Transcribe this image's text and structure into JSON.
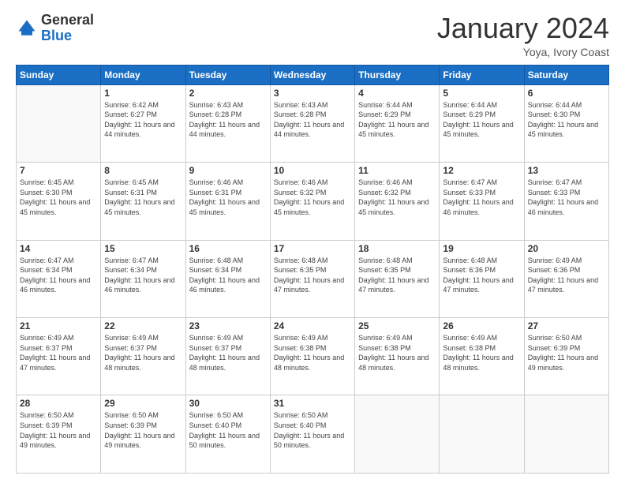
{
  "header": {
    "logo_general": "General",
    "logo_blue": "Blue",
    "month_title": "January 2024",
    "subtitle": "Yoya, Ivory Coast"
  },
  "days_of_week": [
    "Sunday",
    "Monday",
    "Tuesday",
    "Wednesday",
    "Thursday",
    "Friday",
    "Saturday"
  ],
  "weeks": [
    [
      {
        "day": "",
        "sunrise": "",
        "sunset": "",
        "daylight": ""
      },
      {
        "day": "1",
        "sunrise": "Sunrise: 6:42 AM",
        "sunset": "Sunset: 6:27 PM",
        "daylight": "Daylight: 11 hours and 44 minutes."
      },
      {
        "day": "2",
        "sunrise": "Sunrise: 6:43 AM",
        "sunset": "Sunset: 6:28 PM",
        "daylight": "Daylight: 11 hours and 44 minutes."
      },
      {
        "day": "3",
        "sunrise": "Sunrise: 6:43 AM",
        "sunset": "Sunset: 6:28 PM",
        "daylight": "Daylight: 11 hours and 44 minutes."
      },
      {
        "day": "4",
        "sunrise": "Sunrise: 6:44 AM",
        "sunset": "Sunset: 6:29 PM",
        "daylight": "Daylight: 11 hours and 45 minutes."
      },
      {
        "day": "5",
        "sunrise": "Sunrise: 6:44 AM",
        "sunset": "Sunset: 6:29 PM",
        "daylight": "Daylight: 11 hours and 45 minutes."
      },
      {
        "day": "6",
        "sunrise": "Sunrise: 6:44 AM",
        "sunset": "Sunset: 6:30 PM",
        "daylight": "Daylight: 11 hours and 45 minutes."
      }
    ],
    [
      {
        "day": "7",
        "sunrise": "Sunrise: 6:45 AM",
        "sunset": "Sunset: 6:30 PM",
        "daylight": "Daylight: 11 hours and 45 minutes."
      },
      {
        "day": "8",
        "sunrise": "Sunrise: 6:45 AM",
        "sunset": "Sunset: 6:31 PM",
        "daylight": "Daylight: 11 hours and 45 minutes."
      },
      {
        "day": "9",
        "sunrise": "Sunrise: 6:46 AM",
        "sunset": "Sunset: 6:31 PM",
        "daylight": "Daylight: 11 hours and 45 minutes."
      },
      {
        "day": "10",
        "sunrise": "Sunrise: 6:46 AM",
        "sunset": "Sunset: 6:32 PM",
        "daylight": "Daylight: 11 hours and 45 minutes."
      },
      {
        "day": "11",
        "sunrise": "Sunrise: 6:46 AM",
        "sunset": "Sunset: 6:32 PM",
        "daylight": "Daylight: 11 hours and 45 minutes."
      },
      {
        "day": "12",
        "sunrise": "Sunrise: 6:47 AM",
        "sunset": "Sunset: 6:33 PM",
        "daylight": "Daylight: 11 hours and 46 minutes."
      },
      {
        "day": "13",
        "sunrise": "Sunrise: 6:47 AM",
        "sunset": "Sunset: 6:33 PM",
        "daylight": "Daylight: 11 hours and 46 minutes."
      }
    ],
    [
      {
        "day": "14",
        "sunrise": "Sunrise: 6:47 AM",
        "sunset": "Sunset: 6:34 PM",
        "daylight": "Daylight: 11 hours and 46 minutes."
      },
      {
        "day": "15",
        "sunrise": "Sunrise: 6:47 AM",
        "sunset": "Sunset: 6:34 PM",
        "daylight": "Daylight: 11 hours and 46 minutes."
      },
      {
        "day": "16",
        "sunrise": "Sunrise: 6:48 AM",
        "sunset": "Sunset: 6:34 PM",
        "daylight": "Daylight: 11 hours and 46 minutes."
      },
      {
        "day": "17",
        "sunrise": "Sunrise: 6:48 AM",
        "sunset": "Sunset: 6:35 PM",
        "daylight": "Daylight: 11 hours and 47 minutes."
      },
      {
        "day": "18",
        "sunrise": "Sunrise: 6:48 AM",
        "sunset": "Sunset: 6:35 PM",
        "daylight": "Daylight: 11 hours and 47 minutes."
      },
      {
        "day": "19",
        "sunrise": "Sunrise: 6:48 AM",
        "sunset": "Sunset: 6:36 PM",
        "daylight": "Daylight: 11 hours and 47 minutes."
      },
      {
        "day": "20",
        "sunrise": "Sunrise: 6:49 AM",
        "sunset": "Sunset: 6:36 PM",
        "daylight": "Daylight: 11 hours and 47 minutes."
      }
    ],
    [
      {
        "day": "21",
        "sunrise": "Sunrise: 6:49 AM",
        "sunset": "Sunset: 6:37 PM",
        "daylight": "Daylight: 11 hours and 47 minutes."
      },
      {
        "day": "22",
        "sunrise": "Sunrise: 6:49 AM",
        "sunset": "Sunset: 6:37 PM",
        "daylight": "Daylight: 11 hours and 48 minutes."
      },
      {
        "day": "23",
        "sunrise": "Sunrise: 6:49 AM",
        "sunset": "Sunset: 6:37 PM",
        "daylight": "Daylight: 11 hours and 48 minutes."
      },
      {
        "day": "24",
        "sunrise": "Sunrise: 6:49 AM",
        "sunset": "Sunset: 6:38 PM",
        "daylight": "Daylight: 11 hours and 48 minutes."
      },
      {
        "day": "25",
        "sunrise": "Sunrise: 6:49 AM",
        "sunset": "Sunset: 6:38 PM",
        "daylight": "Daylight: 11 hours and 48 minutes."
      },
      {
        "day": "26",
        "sunrise": "Sunrise: 6:49 AM",
        "sunset": "Sunset: 6:38 PM",
        "daylight": "Daylight: 11 hours and 48 minutes."
      },
      {
        "day": "27",
        "sunrise": "Sunrise: 6:50 AM",
        "sunset": "Sunset: 6:39 PM",
        "daylight": "Daylight: 11 hours and 49 minutes."
      }
    ],
    [
      {
        "day": "28",
        "sunrise": "Sunrise: 6:50 AM",
        "sunset": "Sunset: 6:39 PM",
        "daylight": "Daylight: 11 hours and 49 minutes."
      },
      {
        "day": "29",
        "sunrise": "Sunrise: 6:50 AM",
        "sunset": "Sunset: 6:39 PM",
        "daylight": "Daylight: 11 hours and 49 minutes."
      },
      {
        "day": "30",
        "sunrise": "Sunrise: 6:50 AM",
        "sunset": "Sunset: 6:40 PM",
        "daylight": "Daylight: 11 hours and 50 minutes."
      },
      {
        "day": "31",
        "sunrise": "Sunrise: 6:50 AM",
        "sunset": "Sunset: 6:40 PM",
        "daylight": "Daylight: 11 hours and 50 minutes."
      },
      {
        "day": "",
        "sunrise": "",
        "sunset": "",
        "daylight": ""
      },
      {
        "day": "",
        "sunrise": "",
        "sunset": "",
        "daylight": ""
      },
      {
        "day": "",
        "sunrise": "",
        "sunset": "",
        "daylight": ""
      }
    ]
  ]
}
